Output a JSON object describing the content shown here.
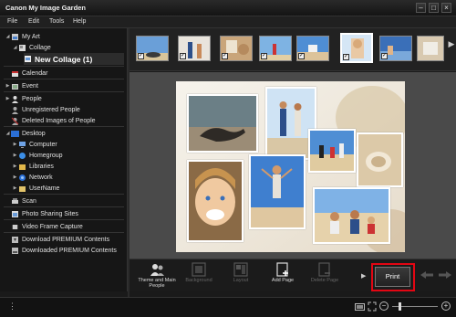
{
  "window": {
    "title": "Canon My Image Garden",
    "minimize": "–",
    "maximize": "□",
    "close": "×"
  },
  "menu": [
    "File",
    "Edit",
    "Tools",
    "Help"
  ],
  "sidebar": {
    "my_art": "My Art",
    "collage": "Collage",
    "new_collage": "New Collage (1)",
    "calendar": "Calendar",
    "event": "Event",
    "people": "People",
    "unregistered_people": "Unregistered People",
    "deleted_images": "Deleted Images of People",
    "desktop": "Desktop",
    "computer": "Computer",
    "homegroup": "Homegroup",
    "libraries": "Libraries",
    "network": "Network",
    "username": "UserName",
    "scan": "Scan",
    "photo_sharing": "Photo Sharing Sites",
    "video_frame": "Video Frame Capture",
    "download_premium": "Download PREMIUM Contents",
    "downloaded_premium": "Downloaded PREMIUM Contents"
  },
  "toolbar": {
    "theme": "Theme and Main People",
    "background": "Background",
    "layout": "Layout",
    "add_page": "Add Page",
    "delete_page": "Delete Page",
    "print": "Print"
  },
  "colors": {
    "accent_red": "#e30613",
    "tree_blue": "#2b6fd6"
  }
}
